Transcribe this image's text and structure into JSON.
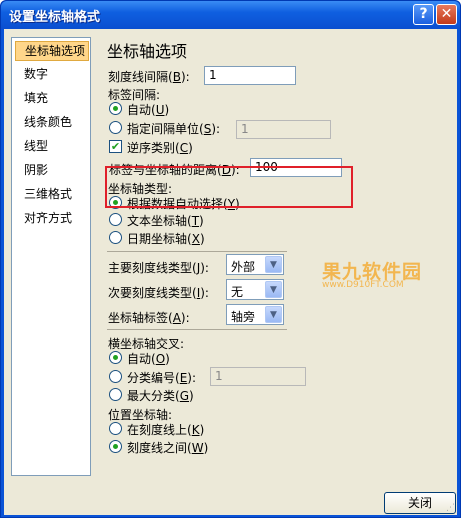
{
  "window": {
    "title": "设置坐标轴格式"
  },
  "titlebar": {
    "help_label": "?",
    "close_label": "✕"
  },
  "sidebar": {
    "items": [
      {
        "label": "坐标轴选项"
      },
      {
        "label": "数字"
      },
      {
        "label": "填充"
      },
      {
        "label": "线条颜色"
      },
      {
        "label": "线型"
      },
      {
        "label": "阴影"
      },
      {
        "label": "三维格式"
      },
      {
        "label": "对齐方式"
      }
    ]
  },
  "panel": {
    "heading": "坐标轴选项",
    "tick_interval": {
      "label": "刻度线间隔",
      "key": "B",
      "value": "1"
    },
    "label_interval": {
      "label": "标签间隔:",
      "auto": {
        "label": "自动",
        "key": "U",
        "selected": true
      },
      "specify": {
        "label": "指定间隔单位",
        "key": "S",
        "selected": false,
        "value": "1"
      }
    },
    "reverse_order": {
      "label": "逆序类别",
      "key": "C",
      "checked": true
    },
    "label_distance": {
      "label": "标签与坐标轴的距离",
      "key": "D",
      "value": "100"
    },
    "axis_type": {
      "label": "坐标轴类型:",
      "options": [
        {
          "label": "根据数据自动选择",
          "key": "Y",
          "selected": true
        },
        {
          "label": "文本坐标轴",
          "key": "T",
          "selected": false
        },
        {
          "label": "日期坐标轴",
          "key": "X",
          "selected": false
        }
      ]
    },
    "major_tick_type": {
      "label": "主要刻度线类型",
      "key": "J",
      "value": "外部"
    },
    "minor_tick_type": {
      "label": "次要刻度线类型",
      "key": "I",
      "value": "无"
    },
    "axis_labels": {
      "label": "坐标轴标签",
      "key": "A",
      "value": "轴旁"
    },
    "horizontal_cross": {
      "label": "横坐标轴交叉:",
      "options": [
        {
          "label": "自动",
          "key": "O",
          "selected": true
        },
        {
          "label": "分类编号",
          "key": "E",
          "selected": false,
          "value": "1"
        },
        {
          "label": "最大分类",
          "key": "G",
          "selected": false
        }
      ]
    },
    "axis_position": {
      "label": "位置坐标轴:",
      "options": [
        {
          "label": "在刻度线上",
          "key": "K",
          "selected": false
        },
        {
          "label": "刻度线之间",
          "key": "W",
          "selected": true
        }
      ]
    }
  },
  "watermark": {
    "line1": "果九软件园",
    "line2": "www.D910FT.COM"
  },
  "footer": {
    "close_label": "关闭"
  },
  "colors": {
    "highlight_border": "#e0202a",
    "titlebar": "#0a53d6",
    "dialog_bg": "#ece9d8"
  }
}
